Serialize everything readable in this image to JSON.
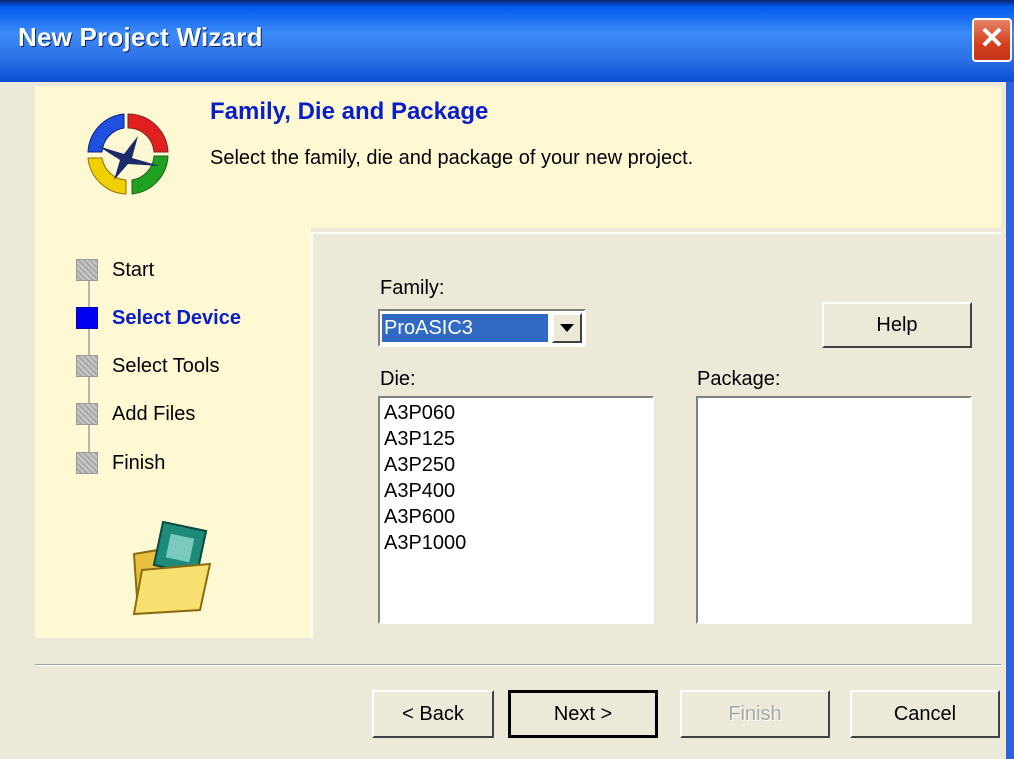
{
  "window": {
    "title": "New Project Wizard",
    "close_label": "✕"
  },
  "header": {
    "title": "Family, Die and Package",
    "subtitle": "Select the family, die and package of your new project."
  },
  "steps": [
    {
      "label": "Start",
      "active": false
    },
    {
      "label": "Select Device",
      "active": true
    },
    {
      "label": "Select Tools",
      "active": false
    },
    {
      "label": "Add Files",
      "active": false
    },
    {
      "label": "Finish",
      "active": false
    }
  ],
  "family": {
    "label": "Family:",
    "value": "ProASIC3"
  },
  "help_label": "Help",
  "die": {
    "label": "Die:",
    "items": [
      "A3P060",
      "A3P125",
      "A3P250",
      "A3P400",
      "A3P600",
      "A3P1000"
    ]
  },
  "package": {
    "label": "Package:",
    "items": []
  },
  "buttons": {
    "back": "< Back",
    "next": "Next >",
    "finish": "Finish",
    "cancel": "Cancel"
  },
  "colors": {
    "title_bar": "#0058EE",
    "panel_bg": "#FFF9D3",
    "accent_blue": "#0A1EC8",
    "selection": "#316AC5"
  }
}
